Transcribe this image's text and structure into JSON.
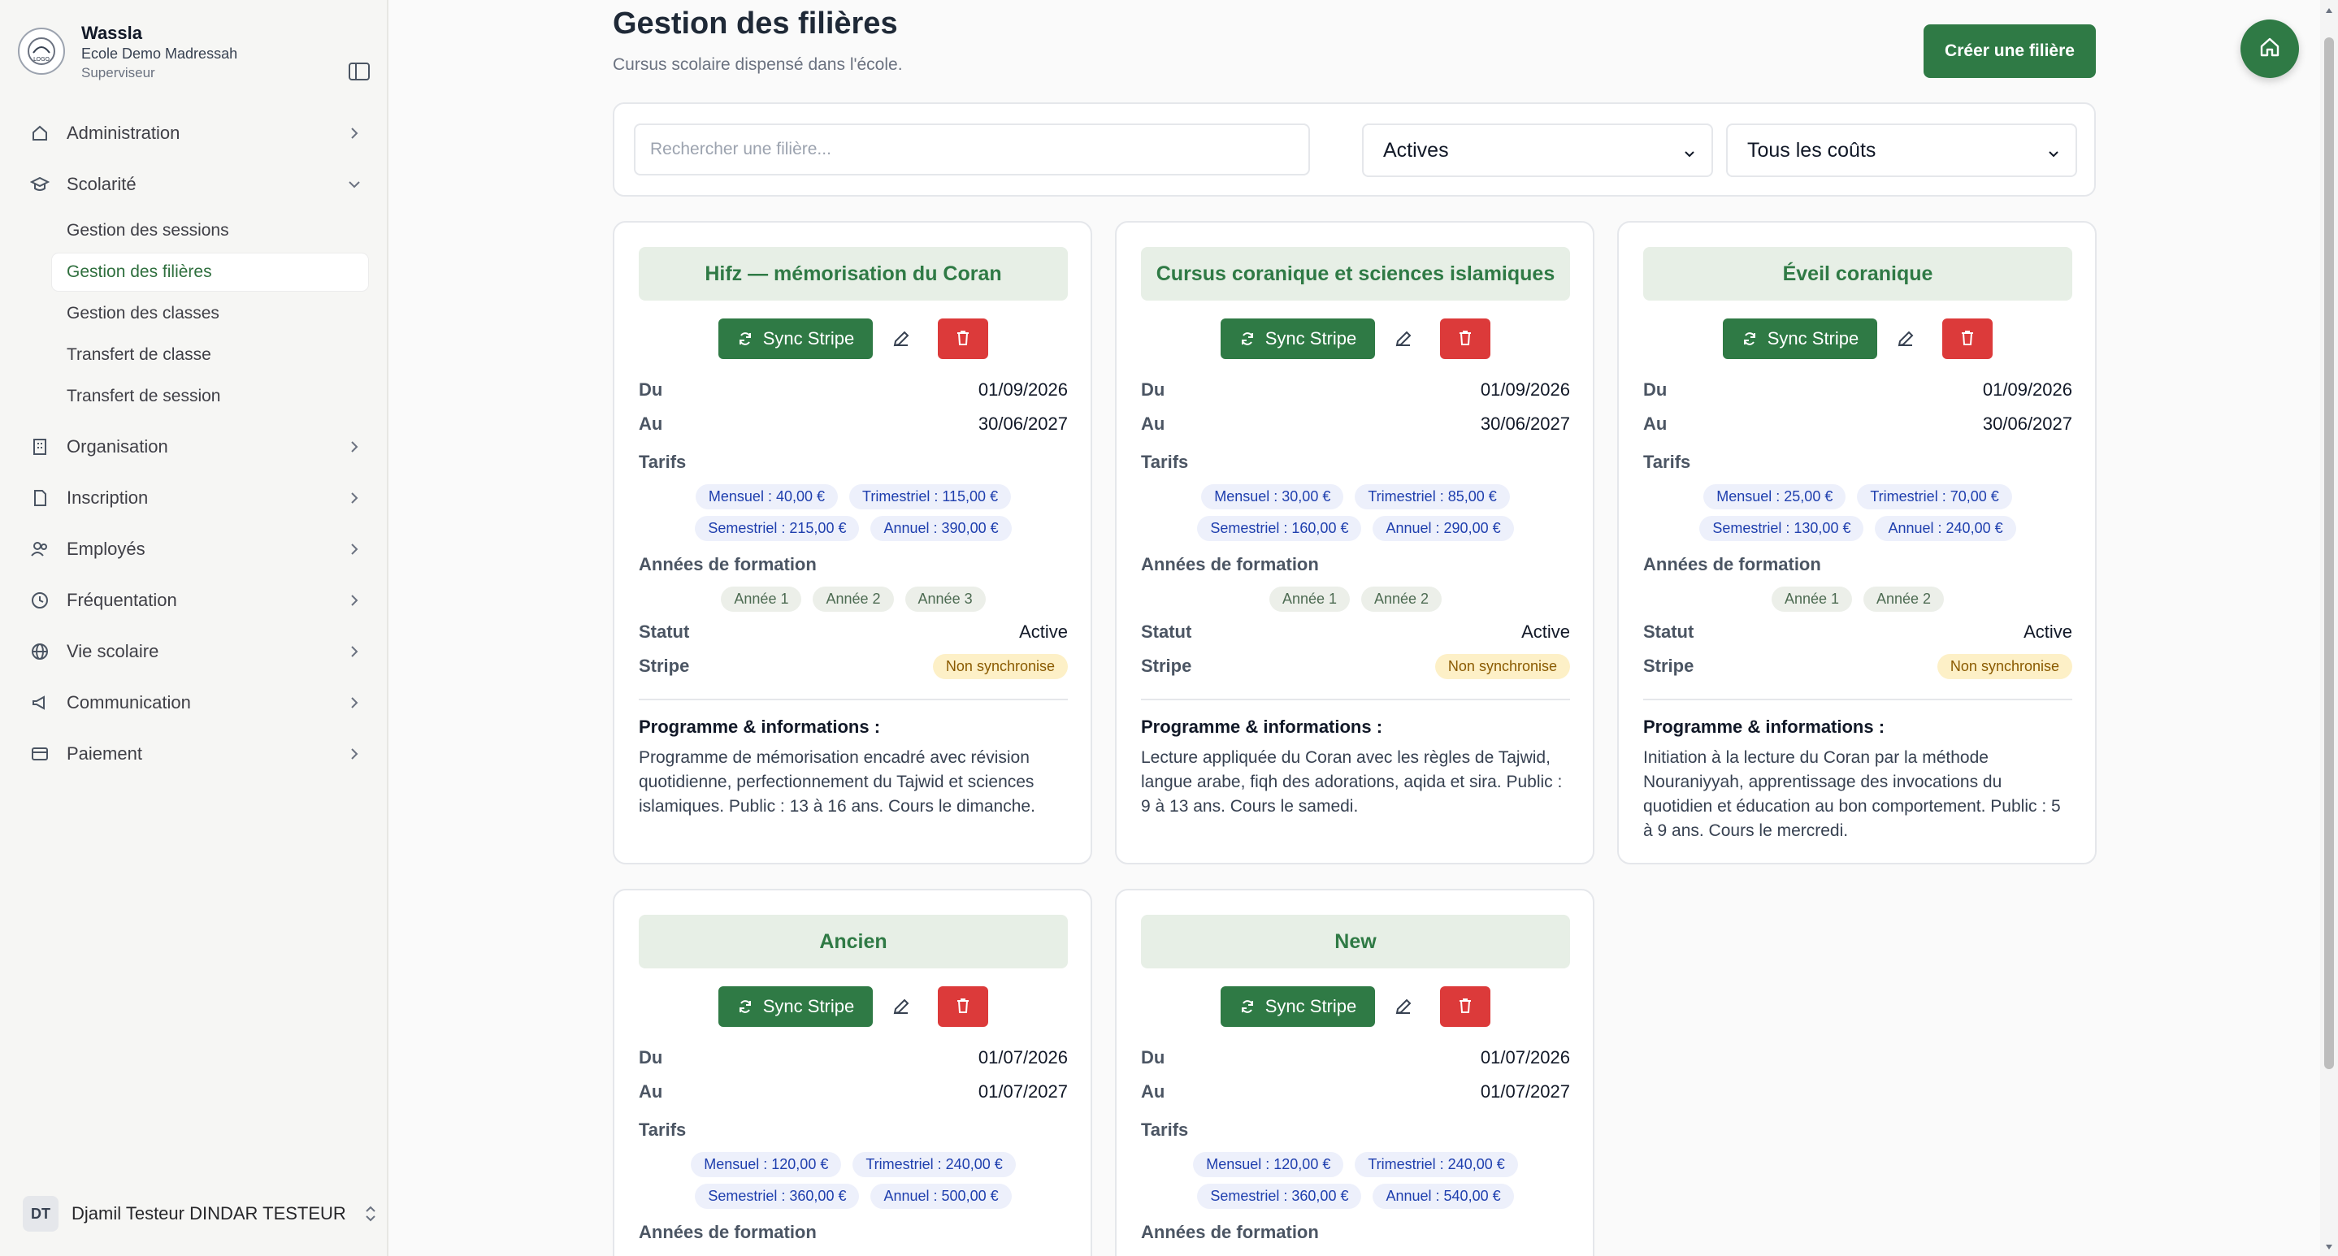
{
  "sidebar": {
    "brand": {
      "name": "Wassla",
      "school": "Ecole Demo Madressah",
      "role": "Superviseur"
    },
    "items": [
      {
        "label": "Administration",
        "icon": "home-icon"
      },
      {
        "label": "Scolarité",
        "icon": "graduation-cap-icon",
        "expanded": true
      },
      {
        "label": "Organisation",
        "icon": "building-icon"
      },
      {
        "label": "Inscription",
        "icon": "file-icon"
      },
      {
        "label": "Employés",
        "icon": "users-icon"
      },
      {
        "label": "Fréquentation",
        "icon": "clock-icon"
      },
      {
        "label": "Vie scolaire",
        "icon": "globe-icon"
      },
      {
        "label": "Communication",
        "icon": "megaphone-icon"
      },
      {
        "label": "Paiement",
        "icon": "credit-card-icon"
      }
    ],
    "subitems": [
      {
        "label": "Gestion des sessions"
      },
      {
        "label": "Gestion des filières",
        "active": true
      },
      {
        "label": "Gestion des classes"
      },
      {
        "label": "Transfert de classe"
      },
      {
        "label": "Transfert de session"
      }
    ],
    "user": {
      "initials": "DT",
      "name": "Djamil Testeur DINDAR TESTEUR"
    }
  },
  "header": {
    "title": "Gestion des filières",
    "subtitle": "Cursus scolaire dispensé dans l'école.",
    "create_label": "Créer une filière"
  },
  "filters": {
    "search_placeholder": "Rechercher une filière...",
    "status_value": "Actives",
    "cost_value": "Tous les coûts"
  },
  "labels": {
    "sync": "Sync Stripe",
    "du": "Du",
    "au": "Au",
    "tarifs": "Tarifs",
    "annees": "Années de formation",
    "statut": "Statut",
    "stripe": "Stripe",
    "programme": "Programme & informations :"
  },
  "cards": [
    {
      "title": "Hifz — mémorisation du Coran",
      "du": "01/09/2026",
      "au": "30/06/2027",
      "tarifs_row1": [
        "Mensuel : 40,00 €",
        "Trimestriel : 115,00 €"
      ],
      "tarifs_row2": [
        "Semestriel : 215,00 €",
        "Annuel : 390,00 €"
      ],
      "annees": [
        "Année 1",
        "Année 2",
        "Année 3"
      ],
      "statut": "Active",
      "stripe": "Non synchronise",
      "programme": "Programme de mémorisation encadré avec révision quotidienne, perfectionnement du Tajwid et sciences islamiques. Public : 13 à 16 ans. Cours le dimanche."
    },
    {
      "title": "Cursus coranique et sciences islamiques",
      "du": "01/09/2026",
      "au": "30/06/2027",
      "tarifs_row1": [
        "Mensuel : 30,00 €",
        "Trimestriel : 85,00 €"
      ],
      "tarifs_row2": [
        "Semestriel : 160,00 €",
        "Annuel : 290,00 €"
      ],
      "annees": [
        "Année 1",
        "Année 2"
      ],
      "statut": "Active",
      "stripe": "Non synchronise",
      "programme": "Lecture appliquée du Coran avec les règles de Tajwid, langue arabe, fiqh des adorations, aqida et sira. Public : 9 à 13 ans. Cours le samedi."
    },
    {
      "title": "Éveil coranique",
      "du": "01/09/2026",
      "au": "30/06/2027",
      "tarifs_row1": [
        "Mensuel : 25,00 €",
        "Trimestriel : 70,00 €"
      ],
      "tarifs_row2": [
        "Semestriel : 130,00 €",
        "Annuel : 240,00 €"
      ],
      "annees": [
        "Année 1",
        "Année 2"
      ],
      "statut": "Active",
      "stripe": "Non synchronise",
      "programme": "Initiation à la lecture du Coran par la méthode Nouraniyyah, apprentissage des invocations du quotidien et éducation au bon comportement. Public : 5 à 9 ans. Cours le mercredi."
    },
    {
      "title": "Ancien",
      "du": "01/07/2026",
      "au": "01/07/2027",
      "tarifs_row1": [
        "Mensuel : 120,00 €",
        "Trimestriel : 240,00 €"
      ],
      "tarifs_row2": [
        "Semestriel : 360,00 €",
        "Annuel : 500,00 €"
      ]
    },
    {
      "title": "New",
      "du": "01/07/2026",
      "au": "01/07/2027",
      "tarifs_row1": [
        "Mensuel : 120,00 €",
        "Trimestriel : 240,00 €"
      ],
      "tarifs_row2": [
        "Semestriel : 360,00 €",
        "Annuel : 540,00 €"
      ]
    }
  ],
  "colors": {
    "primary": "#2f7a45",
    "danger": "#dc3a3a",
    "card_head_bg": "#e7efe6",
    "tarif_chip_bg": "#edf0fb",
    "warning_badge_bg": "#fdf0c7"
  }
}
